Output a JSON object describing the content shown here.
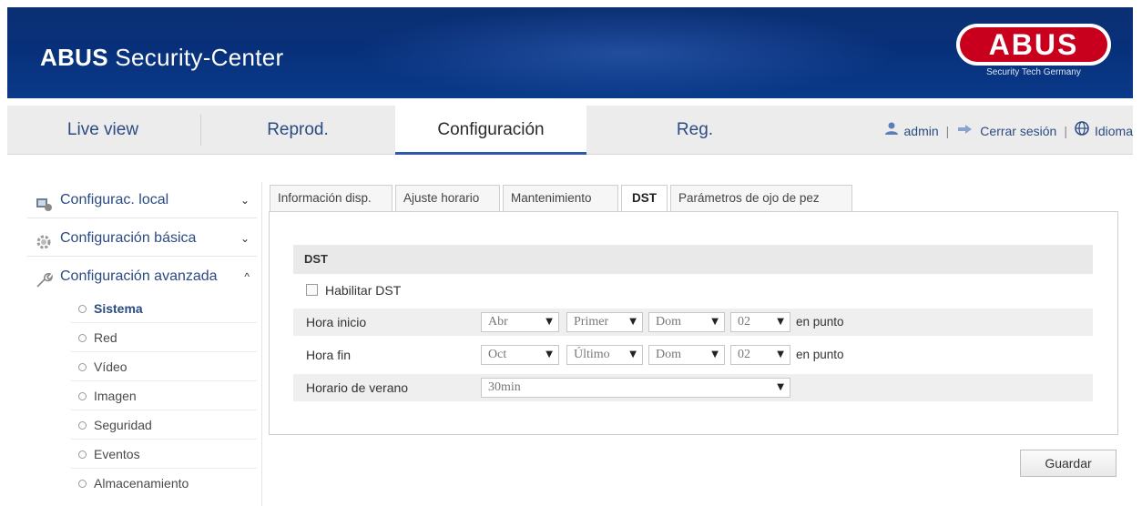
{
  "header": {
    "title_bold": "ABUS",
    "title_rest": " Security-Center",
    "logo_text": "ABUS",
    "logo_tagline": "Security Tech Germany"
  },
  "nav": {
    "tabs": [
      {
        "label": "Live view",
        "active": false
      },
      {
        "label": "Reprod.",
        "active": false
      },
      {
        "label": "Configuración",
        "active": true
      },
      {
        "label": "Reg.",
        "active": false
      }
    ],
    "user": "admin",
    "logout": "Cerrar sesión",
    "language": "Idioma"
  },
  "sidebar": {
    "sections": [
      {
        "label": "Configurac. local",
        "icon": "local-config-icon",
        "chevron": "⌄"
      },
      {
        "label": "Configuración básica",
        "icon": "gear-icon",
        "chevron": "⌄"
      },
      {
        "label": "Configuración avanzada",
        "icon": "wrench-icon",
        "chevron": "^"
      }
    ],
    "items": [
      {
        "label": "Sistema",
        "active": true
      },
      {
        "label": "Red",
        "active": false
      },
      {
        "label": "Vídeo",
        "active": false
      },
      {
        "label": "Imagen",
        "active": false
      },
      {
        "label": "Seguridad",
        "active": false
      },
      {
        "label": "Eventos",
        "active": false
      },
      {
        "label": "Almacenamiento",
        "active": false
      }
    ]
  },
  "tabs": [
    {
      "label": "Información disp.",
      "active": false
    },
    {
      "label": "Ajuste horario",
      "active": false
    },
    {
      "label": "Mantenimiento",
      "active": false
    },
    {
      "label": "DST",
      "active": true
    },
    {
      "label": "Parámetros de ojo de pez",
      "active": false
    }
  ],
  "form": {
    "section_title": "DST",
    "enable_label": "Habilitar DST",
    "enable_checked": false,
    "start": {
      "label": "Hora inicio",
      "month": "Abr",
      "week": "Primer",
      "day": "Dom",
      "hour": "02",
      "suffix": "en punto"
    },
    "end": {
      "label": "Hora fin",
      "month": "Oct",
      "week": "Último",
      "day": "Dom",
      "hour": "02",
      "suffix": "en punto"
    },
    "offset": {
      "label": "Horario de verano",
      "value": "30min"
    },
    "save_label": "Guardar"
  },
  "colors": {
    "header_bg": "#08307a",
    "nav_link": "#2b4b82",
    "logo_red": "#c8001e",
    "active_underline": "#2d5aa8"
  }
}
